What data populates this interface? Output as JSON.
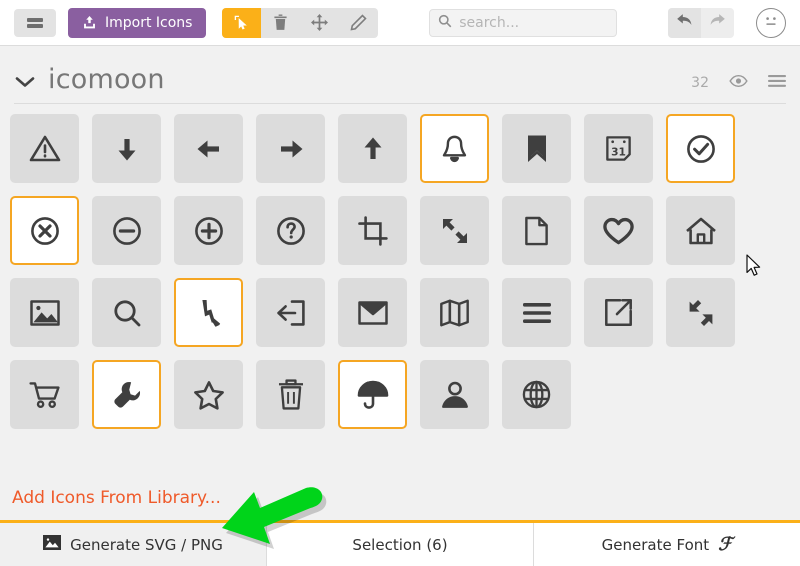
{
  "toolbar": {
    "menu_button": "menu-button",
    "import_label": "Import Icons",
    "tools": [
      {
        "name": "select-tool",
        "active": true
      },
      {
        "name": "delete-tool",
        "active": false
      },
      {
        "name": "move-tool",
        "active": false
      },
      {
        "name": "edit-tool",
        "active": false
      }
    ],
    "search": {
      "value": "",
      "placeholder": "search..."
    },
    "undo": "undo-button",
    "redo": "redo-button",
    "face": "face-icon"
  },
  "set": {
    "title": "icomoon",
    "count": "32",
    "eye": "eye-icon",
    "menu": "list-menu-icon"
  },
  "icons": [
    {
      "name": "warning-icon",
      "selected": false
    },
    {
      "name": "arrow-down-icon",
      "selected": false
    },
    {
      "name": "arrow-left-icon",
      "selected": false
    },
    {
      "name": "arrow-right-icon",
      "selected": false
    },
    {
      "name": "arrow-up-icon",
      "selected": false
    },
    {
      "name": "bell-icon",
      "selected": true
    },
    {
      "name": "bookmark-icon",
      "selected": false
    },
    {
      "name": "calendar-icon",
      "selected": false
    },
    {
      "name": "check-circle-icon",
      "selected": true
    },
    {
      "name": "x-circle-icon",
      "selected": true
    },
    {
      "name": "minus-circle-icon",
      "selected": false
    },
    {
      "name": "plus-circle-icon",
      "selected": false
    },
    {
      "name": "question-circle-icon",
      "selected": false
    },
    {
      "name": "crop-icon",
      "selected": false
    },
    {
      "name": "expand-icon",
      "selected": false
    },
    {
      "name": "file-icon",
      "selected": false
    },
    {
      "name": "heart-icon",
      "selected": false
    },
    {
      "name": "home-icon",
      "selected": false
    },
    {
      "name": "image-icon",
      "selected": false
    },
    {
      "name": "search-icon",
      "selected": false
    },
    {
      "name": "zigzag-arrow-icon",
      "selected": true
    },
    {
      "name": "login-icon",
      "selected": false
    },
    {
      "name": "mail-icon",
      "selected": false
    },
    {
      "name": "map-icon",
      "selected": false
    },
    {
      "name": "hamburger-icon",
      "selected": false
    },
    {
      "name": "external-link-icon",
      "selected": false
    },
    {
      "name": "shrink-icon",
      "selected": false
    },
    {
      "name": "cart-icon",
      "selected": false
    },
    {
      "name": "wrench-icon",
      "selected": true
    },
    {
      "name": "star-icon",
      "selected": false
    },
    {
      "name": "trash-icon",
      "selected": false
    },
    {
      "name": "umbrella-icon",
      "selected": true
    },
    {
      "name": "user-icon",
      "selected": false
    },
    {
      "name": "globe-icon",
      "selected": false
    }
  ],
  "library_link": "Add Icons From Library...",
  "footer": {
    "tabs": [
      {
        "label": "Generate SVG / PNG",
        "active": false,
        "icon": "image-icon"
      },
      {
        "label": "Selection (6)",
        "active": true,
        "icon": ""
      },
      {
        "label": "Generate Font",
        "active": false,
        "icon": "font-script-icon"
      }
    ]
  },
  "colors": {
    "accent_orange": "#fbb018",
    "selected_border": "#f5a623",
    "import_purple": "#8a5fa0",
    "library_orange": "#ef5a2a",
    "annotation_green": "#00d41a",
    "tile_gray": "#dcdcdc",
    "icon_dark": "#3f3f3f"
  },
  "annotation": {
    "arrow": "green-pointer-arrow"
  },
  "cursor": {
    "pointer": "mouse-cursor"
  }
}
